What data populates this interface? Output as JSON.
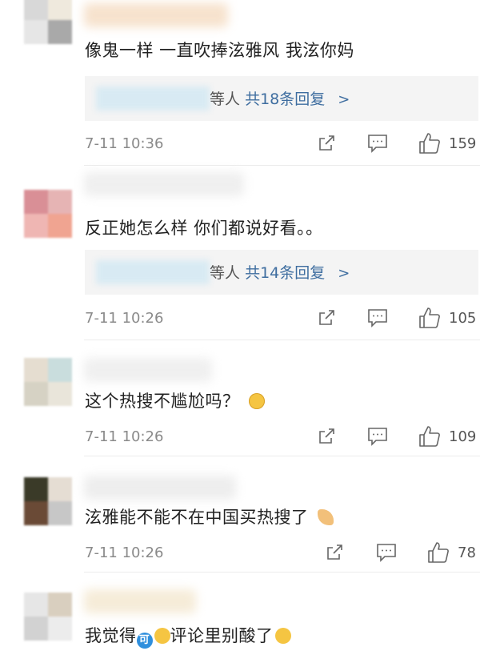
{
  "comments": [
    {
      "text": "像鬼一样 一直吹捧泫雅风 我泫你妈",
      "reply": {
        "prefix": "等人",
        "link": "共18条回复",
        "chevron": ">"
      },
      "time": "7-11 10:36",
      "likes": "159"
    },
    {
      "text": "反正她怎么样 你们都说好看。。",
      "reply": {
        "prefix": "等人",
        "link": "共14条回复",
        "chevron": ">"
      },
      "time": "7-11 10:26",
      "likes": "105"
    },
    {
      "text": "这个热搜不尴尬吗？",
      "time": "7-11 10:26",
      "likes": "109"
    },
    {
      "text": "泫雅能不能不在中国买热搜了",
      "time": "7-11 10:26",
      "likes": "78"
    },
    {
      "text_part1": "我觉得",
      "badge": "可",
      "text_part2": "评论里别酸了"
    }
  ],
  "icons": {
    "forward": "forward-icon",
    "comment": "comment-icon",
    "like": "thumbs-up-icon"
  },
  "colors": {
    "link": "#3f6ea0",
    "timestamp": "#8a8a8a"
  }
}
